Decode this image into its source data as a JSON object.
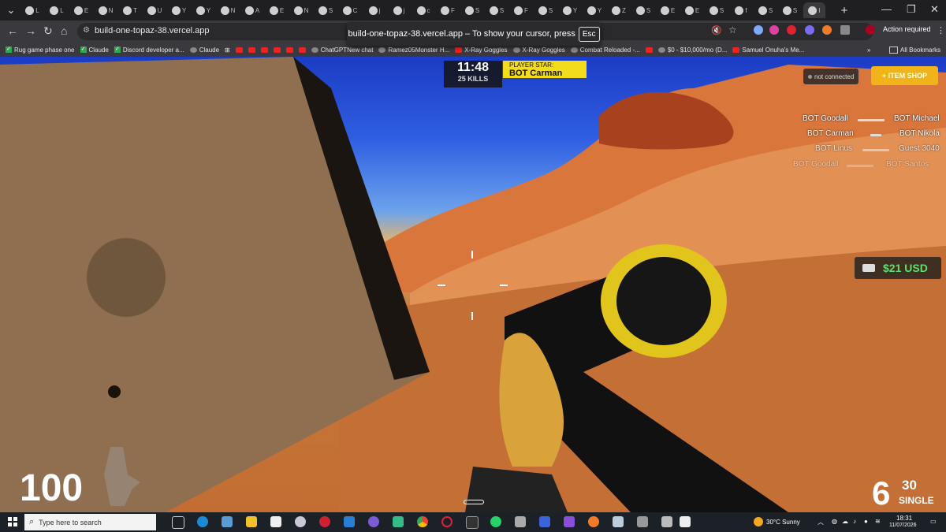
{
  "tabs": [
    {
      "label": "L"
    },
    {
      "label": "L"
    },
    {
      "label": "E"
    },
    {
      "label": "N"
    },
    {
      "label": "T"
    },
    {
      "label": "U"
    },
    {
      "label": "Y"
    },
    {
      "label": "Y"
    },
    {
      "label": "N"
    },
    {
      "label": "A"
    },
    {
      "label": "E"
    },
    {
      "label": "N"
    },
    {
      "label": "S"
    },
    {
      "label": "C"
    },
    {
      "label": "j"
    },
    {
      "label": "j"
    },
    {
      "label": "c"
    },
    {
      "label": "F"
    },
    {
      "label": "S"
    },
    {
      "label": "S"
    },
    {
      "label": "F"
    },
    {
      "label": "S"
    },
    {
      "label": "Y"
    },
    {
      "label": "Y"
    },
    {
      "label": "Z"
    },
    {
      "label": "S"
    },
    {
      "label": "E"
    },
    {
      "label": "E"
    },
    {
      "label": "S"
    },
    {
      "label": "f"
    },
    {
      "label": "S"
    },
    {
      "label": "S"
    },
    {
      "label": "I"
    }
  ],
  "browser": {
    "url": "build-one-topaz-38.vercel.app",
    "fullscreen_message": "build-one-topaz-38.vercel.app – To show your cursor, press",
    "esc_key": "Esc",
    "action_required": "Action required",
    "new_tab": "+",
    "all_bookmarks": "All Bookmarks"
  },
  "bookmarks": [
    {
      "label": "Rug game phase one",
      "type": "check"
    },
    {
      "label": "Claude",
      "type": "check"
    },
    {
      "label": "Discord developer a...",
      "type": "check"
    },
    {
      "label": "Claude",
      "type": "plain"
    },
    {
      "label": "",
      "type": "grid"
    },
    {
      "label": "",
      "type": "yt"
    },
    {
      "label": "",
      "type": "yt"
    },
    {
      "label": "",
      "type": "yt"
    },
    {
      "label": "",
      "type": "yt"
    },
    {
      "label": "",
      "type": "yt"
    },
    {
      "label": "",
      "type": "yt"
    },
    {
      "label": "ChatGPTNew chat",
      "type": "plain"
    },
    {
      "label": "Ramez05Monster H...",
      "type": "plain"
    },
    {
      "label": "X-Ray Goggles",
      "type": "yt"
    },
    {
      "label": "X-Ray Goggles",
      "type": "plain"
    },
    {
      "label": "Combat Reloaded -...",
      "type": "plain"
    },
    {
      "label": "",
      "type": "yt"
    },
    {
      "label": "$0 - $10,000/mo (D...",
      "type": "plain"
    },
    {
      "label": "Samuel Onuha's Me...",
      "type": "yt"
    }
  ],
  "hud": {
    "timer": "11:48",
    "kills": "25 KILLS",
    "player_star_label": "PLAYER STAR:",
    "player_star_name": "BOT Carman",
    "connection": "not connected",
    "item_shop": "+ ITEM SHOP",
    "killfeed": [
      {
        "killer": "BOT Goodall",
        "victim": "BOT Michael"
      },
      {
        "killer": "BOT Carman",
        "victim": "BOT Nikola"
      },
      {
        "killer": "BOT Linus",
        "victim": "Guest 3040"
      },
      {
        "killer": "BOT Goodall",
        "victim": "BOT Santos"
      }
    ],
    "money": "$21 USD",
    "health": "100",
    "ammo": "6",
    "reserve": "30",
    "fire_mode": "SINGLE"
  },
  "taskbar": {
    "search_placeholder": "Type here to search",
    "weather": "30°C  Sunny",
    "time": "18:31",
    "date": "11/07/2026"
  },
  "colors": {
    "accent_yellow": "#f2dc1c",
    "shop_orange": "#f0b319",
    "money_green": "#5ee06d"
  }
}
